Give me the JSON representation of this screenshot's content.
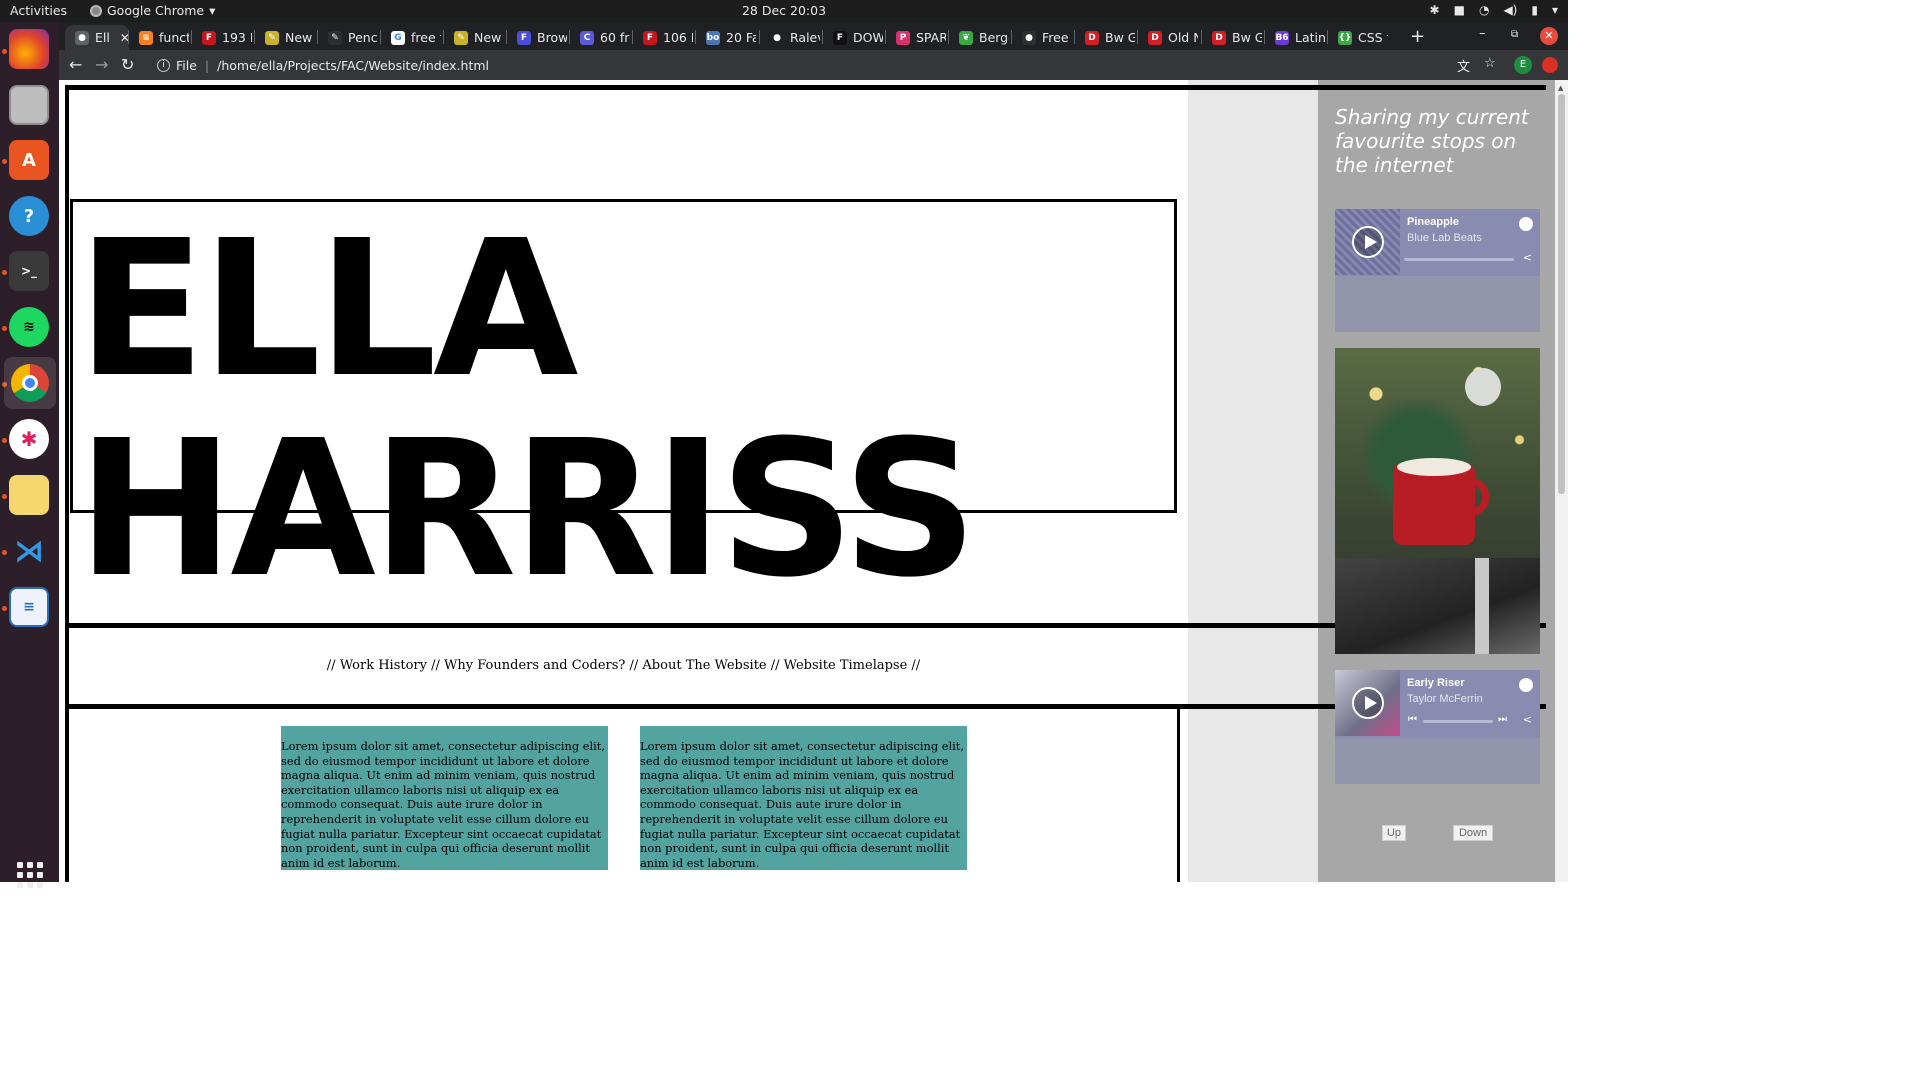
{
  "desktop": {
    "activities": "Activities",
    "app_name": "Google Chrome",
    "clock": "28 Dec  20:03"
  },
  "dock": {
    "apps": [
      "Firefox",
      "Files",
      "Ubuntu Software",
      "Help",
      "Terminal",
      "Spotify",
      "Google Chrome",
      "Slack",
      "Sticky Notes",
      "Visual Studio Code",
      "LibreOffice Writer"
    ]
  },
  "tabs": [
    {
      "label": "Ell",
      "favicon": "chrome-icon",
      "color": "#5f6368"
    },
    {
      "label": "funct",
      "favicon": "stackoverflow-icon",
      "color": "#f48024"
    },
    {
      "label": "193 F",
      "favicon": "f-icon",
      "color": "#c4161c"
    },
    {
      "label": "New I",
      "favicon": "pencil-icon",
      "color": "#c9b22b"
    },
    {
      "label": "Penci",
      "favicon": "pencil-icon",
      "color": "#2d2e30"
    },
    {
      "label": "free f",
      "favicon": "google-icon",
      "color": "#ffffff"
    },
    {
      "label": "New I",
      "favicon": "pencil-icon",
      "color": "#c9b22b"
    },
    {
      "label": "Brow",
      "favicon": "f-icon",
      "color": "#4a4dd9"
    },
    {
      "label": "60 fre",
      "favicon": "c-icon",
      "color": "#5b5bd6"
    },
    {
      "label": "106 F",
      "favicon": "f-icon",
      "color": "#c4161c"
    },
    {
      "label": "20 Fa",
      "favicon": "bo-icon",
      "color": "#4a76b8"
    },
    {
      "label": "Ralev",
      "favicon": "dot-icon",
      "color": "#202124"
    },
    {
      "label": "DOW",
      "favicon": "f-icon",
      "color": "#111111"
    },
    {
      "label": "SPAR",
      "favicon": "p-icon",
      "color": "#d6336c"
    },
    {
      "label": "Berge",
      "favicon": "leaf-icon",
      "color": "#3aa845"
    },
    {
      "label": "Free I",
      "favicon": "dot-icon",
      "color": "#2d2e30"
    },
    {
      "label": "Bw G",
      "favicon": "d-icon",
      "color": "#d21f26"
    },
    {
      "label": "Old N",
      "favicon": "d-icon",
      "color": "#d21f26"
    },
    {
      "label": "Bw G",
      "favicon": "d-icon",
      "color": "#d21f26"
    },
    {
      "label": "Latin",
      "favicon": "b6-icon",
      "color": "#6a3bd2"
    },
    {
      "label": "CSS f",
      "favicon": "css-icon",
      "color": "#3aa845"
    }
  ],
  "omnibox": {
    "scheme": "File",
    "url": "/home/ella/Projects/FAC/Website/index.html"
  },
  "profile": {
    "initial": "E"
  },
  "page": {
    "name_line1": "ELLA",
    "name_line2": "HARRISS",
    "nav_text": "// Work History // Why Founders and Coders? // About The Website // Website Timelapse //",
    "nav_links": [
      "Work History",
      "Why Founders and Coders?",
      "About The Website",
      "Website Timelapse"
    ],
    "lorem_1": "Lorem ipsum dolor sit amet, consectetur adipiscing elit, sed do eiusmod tempor incididunt ut labore et dolore magna aliqua. Ut enim ad minim veniam, quis nostrud exercitation ullamco laboris nisi ut aliquip ex ea commodo consequat. Duis aute irure dolor in reprehenderit in voluptate velit esse cillum dolore eu fugiat nulla pariatur. Excepteur sint occaecat cupidatat non proident, sunt in culpa qui officia deserunt mollit anim id est laborum.",
    "lorem_2": "Lorem ipsum dolor sit amet, consectetur adipiscing elit, sed do eiusmod tempor incididunt ut labore et dolore magna aliqua. Ut enim ad minim veniam, quis nostrud exercitation ullamco laboris nisi ut aliquip ex ea commodo consequat. Duis aute irure dolor in reprehenderit in voluptate velit esse cillum dolore eu fugiat nulla pariatur. Excepteur sint occaecat cupidatat non proident, sunt in culpa qui officia deserunt mollit anim id est laborum.",
    "lorem_color": "#53a3a0"
  },
  "side_panel": {
    "title": "Sharing my current favourite stops on the internet",
    "spotify_1": {
      "track": "Pineapple",
      "artist": "Blue Lab Beats"
    },
    "spotify_2": {
      "track": "Early Riser",
      "artist": "Taylor McFerrin"
    },
    "up_label": "Up",
    "down_label": "Down"
  }
}
